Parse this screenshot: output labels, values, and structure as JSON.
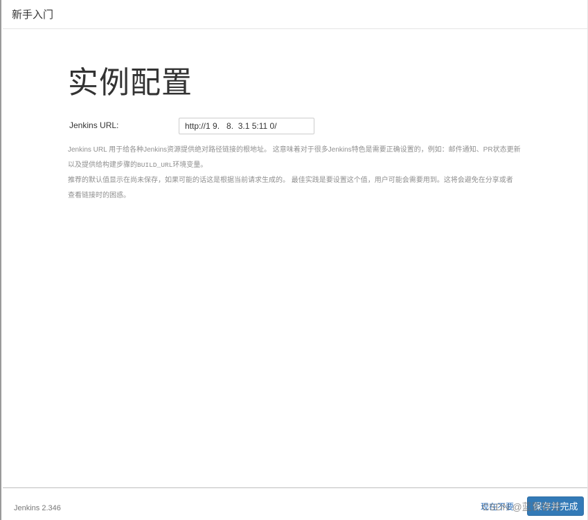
{
  "header": {
    "title": "新手入门"
  },
  "main": {
    "title": "实例配置",
    "url_label": "Jenkins URL:",
    "url_value": "http://1 9.   8.  3.1 5:11 0/",
    "help_line1": "Jenkins URL 用于给各种Jenkins资源提供绝对路径链接的根地址。 这意味着对于很多Jenkins特色是需要正确设置的，例如：邮件通知、PR状态更新",
    "help_line2_prefix": "以及提供给构建步骤的",
    "help_line2_code": "BUILD_URL",
    "help_line2_suffix": "环境变量。",
    "help_line3": "推荐的默认值显示在尚未保存，如果可能的话这是根据当前请求生成的。 最佳实践是要设置这个值，用户可能会需要用到。这将会避免在分享或者",
    "help_line4": "查看链接时的困惑。"
  },
  "footer": {
    "version": "Jenkins 2.346",
    "later_link": "现在不要",
    "save_button": "保存并完成"
  },
  "watermark": "CSDN @蓝影铁哥",
  "colors": {
    "primary": "#337ab7",
    "link": "#2a6ebb",
    "help_text": "#8f8f8f"
  }
}
